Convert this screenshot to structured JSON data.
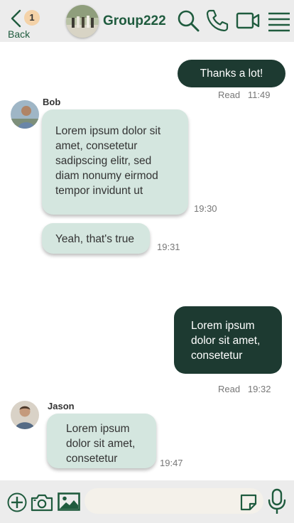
{
  "header": {
    "back_label": "Back",
    "unread_count": "1",
    "group_name": "Group222",
    "icons": [
      "search-icon",
      "phone-icon",
      "video-icon",
      "menu-icon"
    ]
  },
  "messages": [
    {
      "direction": "out",
      "text": "Thanks a lot!",
      "status": "Read",
      "time": "11:49"
    },
    {
      "direction": "in",
      "sender": "Bob",
      "text": "Lorem ipsum dolor sit amet, consetetur sadipscing elitr, sed diam nonumy eirmod tempor invidunt ut",
      "time": "19:30"
    },
    {
      "direction": "in",
      "text": "Yeah, that's true",
      "time": "19:31"
    },
    {
      "direction": "out",
      "text": "Lorem ipsum dolor sit amet, consetetur",
      "status": "Read",
      "time": "19:32"
    },
    {
      "direction": "in",
      "sender": "Jason",
      "text": "Lorem ipsum dolor sit amet, consetetur",
      "time": "19:47"
    }
  ],
  "composer": {
    "input_value": "",
    "placeholder": "",
    "icons": [
      "plus-icon",
      "camera-icon",
      "image-icon",
      "sticker-icon",
      "microphone-icon"
    ]
  },
  "colors": {
    "accent": "#1f5b3e",
    "outgoing_bubble": "#1d3a31",
    "incoming_bubble": "#d4e6df",
    "badge": "#f4d2a8"
  }
}
